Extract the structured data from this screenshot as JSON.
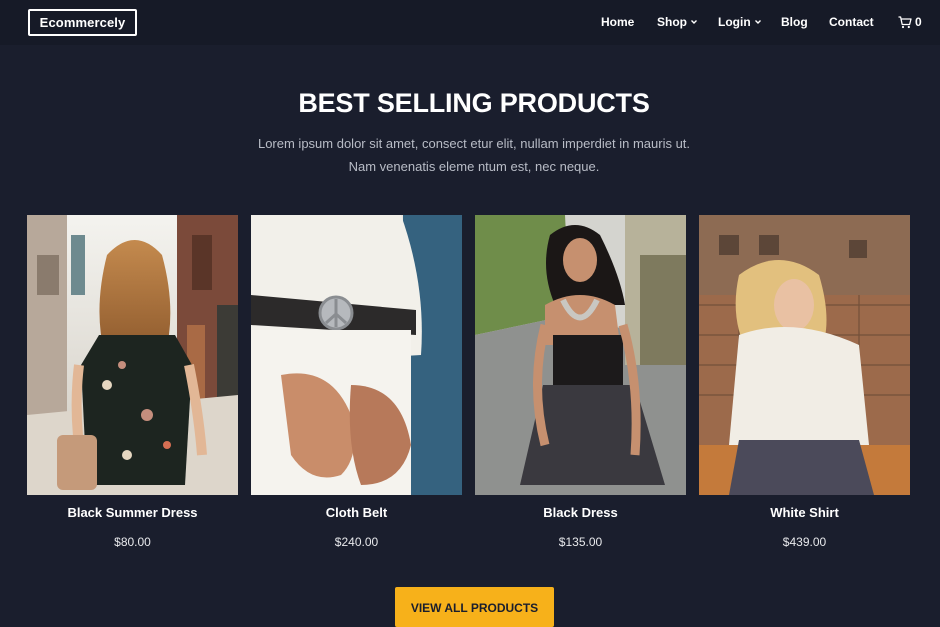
{
  "brand": {
    "name": "Ecommercely"
  },
  "nav": {
    "home": "Home",
    "shop": "Shop",
    "login": "Login",
    "blog": "Blog",
    "contact": "Contact",
    "cart_count": "0"
  },
  "section": {
    "title": "BEST SELLING PRODUCTS",
    "subtitle_line1": "Lorem ipsum dolor sit amet, consect etur elit, nullam imperdiet in mauris ut.",
    "subtitle_line2": "Nam venenatis eleme ntum est, nec neque."
  },
  "products": [
    {
      "name": "Black Summer Dress",
      "price": "$80.00"
    },
    {
      "name": "Cloth Belt",
      "price": "$240.00"
    },
    {
      "name": "Black Dress",
      "price": "$135.00"
    },
    {
      "name": "White Shirt",
      "price": "$439.00"
    }
  ],
  "cta": {
    "label": "VIEW ALL PRODUCTS"
  },
  "colors": {
    "background": "#1a1e2d",
    "navbar": "#161a27",
    "accent": "#f7b11a",
    "text": "#ffffff",
    "muted_text": "#b8bcc6"
  },
  "icons": {
    "cart": "shopping-cart-icon",
    "dropdown": "chevron-down-icon"
  }
}
